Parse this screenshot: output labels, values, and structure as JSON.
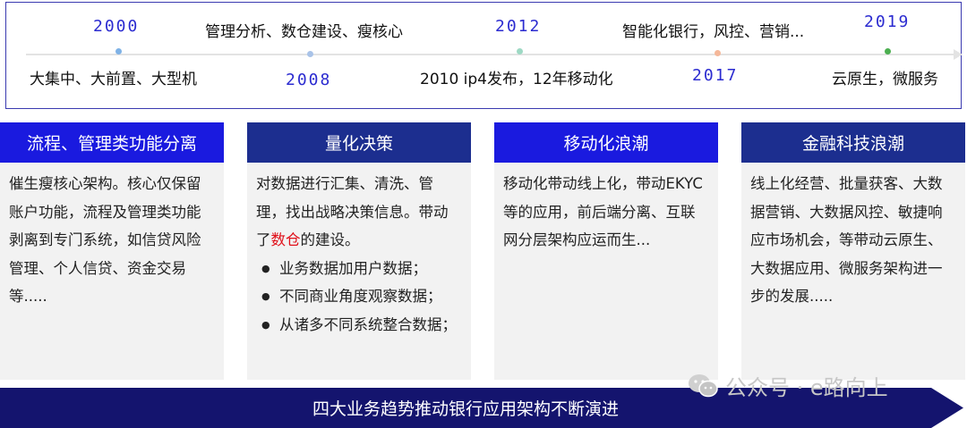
{
  "timeline": {
    "items": [
      {
        "year": "2000",
        "milestone": "大集中、大前置、大型机",
        "color": "#7fb2e6"
      },
      {
        "year": "2008",
        "milestone": "管理分析、数仓建设、瘦核心",
        "color": "#a9c3e8"
      },
      {
        "year": "2012",
        "milestone": "2010 ip4发布，12年移动化",
        "color": "#9ed9c4"
      },
      {
        "year": "2017",
        "milestone": "智能化银行，风控、营销...",
        "color": "#f5b89a"
      },
      {
        "year": "2019",
        "milestone": "云原生，微服务",
        "color": "#4caf50"
      }
    ]
  },
  "columns": [
    {
      "title": "流程、管理类功能分离",
      "header_color": "#1a1adf",
      "text": "催生瘦核心架构。核心仅保留账户功能，流程及管理类功能剥离到专门系统，如信贷风险管理、个人信贷、资金交易等....."
    },
    {
      "title": "量化决策",
      "header_color": "#1c2e8f",
      "text_before": "对数据进行汇集、清洗、管理，找出战略决策信息。带动了",
      "highlight": "数仓",
      "text_after": "的建设。",
      "bullets": [
        "业务数据加用户数据；",
        "不同商业角度观察数据；",
        "从诸多不同系统整合数据；"
      ]
    },
    {
      "title": "移动化浪潮",
      "header_color": "#1a1adf",
      "text": "移动化带动线上化，带动EKYC等的应用，前后端分离、互联网分层架构应运而生..."
    },
    {
      "title": "金融科技浪潮",
      "header_color": "#1c2e8f",
      "text": "线上化经营、批量获客、大数据营销、大数据风控、敏捷响应市场机会，等带动云原生、大数据应用、微服务架构进一步的发展....."
    }
  ],
  "banner": {
    "text": "四大业务趋势推动银行应用架构不断演进",
    "color": "#14146e"
  },
  "watermark": {
    "text": "公众号 · e路向上"
  }
}
